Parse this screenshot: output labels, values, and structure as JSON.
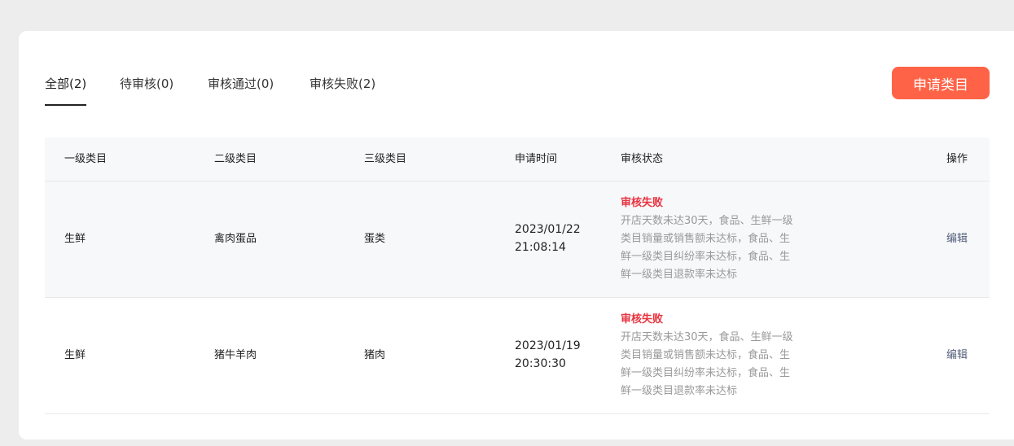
{
  "tabs": [
    {
      "label": "全部(2)",
      "active": true
    },
    {
      "label": "待审核(0)",
      "active": false
    },
    {
      "label": "审核通过(0)",
      "active": false
    },
    {
      "label": "审核失败(2)",
      "active": false
    }
  ],
  "apply_button": "申请类目",
  "colors": {
    "accent": "#ff6347",
    "fail": "#e8333f",
    "link": "#54607a",
    "muted": "#999999"
  },
  "table": {
    "headers": [
      "一级类目",
      "二级类目",
      "三级类目",
      "申请时间",
      "审核状态",
      "操作"
    ],
    "rows": [
      {
        "level1": "生鲜",
        "level2": "禽肉蛋品",
        "level3": "蛋类",
        "date": "2023/01/22",
        "time": "21:08:14",
        "status": "审核失败",
        "reason": [
          "开店天数未达30天，食品、生鲜一级",
          "类目销量或销售额未达标，食品、生",
          "鲜一级类目纠纷率未达标，食品、生",
          "鲜一级类目退款率未达标"
        ],
        "action": "编辑"
      },
      {
        "level1": "生鲜",
        "level2": "猪牛羊肉",
        "level3": "猪肉",
        "date": "2023/01/19",
        "time": "20:30:30",
        "status": "审核失败",
        "reason": [
          "开店天数未达30天，食品、生鲜一级",
          "类目销量或销售额未达标，食品、生",
          "鲜一级类目纠纷率未达标，食品、生",
          "鲜一级类目退款率未达标"
        ],
        "action": "编辑"
      }
    ]
  }
}
